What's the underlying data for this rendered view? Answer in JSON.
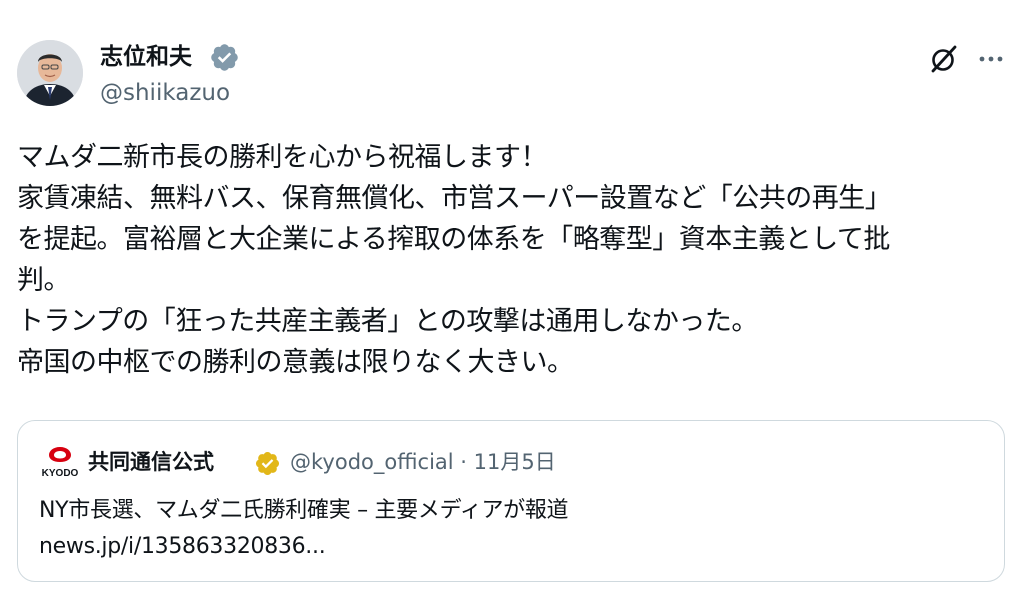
{
  "post": {
    "author": {
      "display_name": "志位和夫",
      "handle": "@shiikazuo",
      "verified": true
    },
    "icons": {
      "grok": "grok-icon",
      "more": "more-options-icon"
    },
    "text_lines": [
      "マムダ二新市長の勝利を心から祝福します！",
      "家賃凍結、無料バス、保育無償化、市営スーパー設置など「公共の再生」",
      "を提起。富裕層と大企業による搾取の体系を「略奪型」資本主義として批",
      "判。",
      "トランプの「狂った共産主義者」との攻撃は通用しなかった。",
      "帝国の中枢での勝利の意義は限りなく大きい。"
    ]
  },
  "quote": {
    "logo_text": "KYODO",
    "display_name": "共同通信公式",
    "verified": true,
    "meta": "@kyodo_official · 11月5日",
    "text_lines": [
      "NY市長選、マムダ二氏勝利確実 – 主要メディアが報道",
      "news.jp/i/135863320836..."
    ]
  },
  "colors": {
    "text": "#0f1419",
    "secondary": "#536471",
    "verified_blue": "#829aab",
    "verified_gold": "#e2b719",
    "border": "#cfd9de",
    "kyodo_red": "#d7000f"
  }
}
